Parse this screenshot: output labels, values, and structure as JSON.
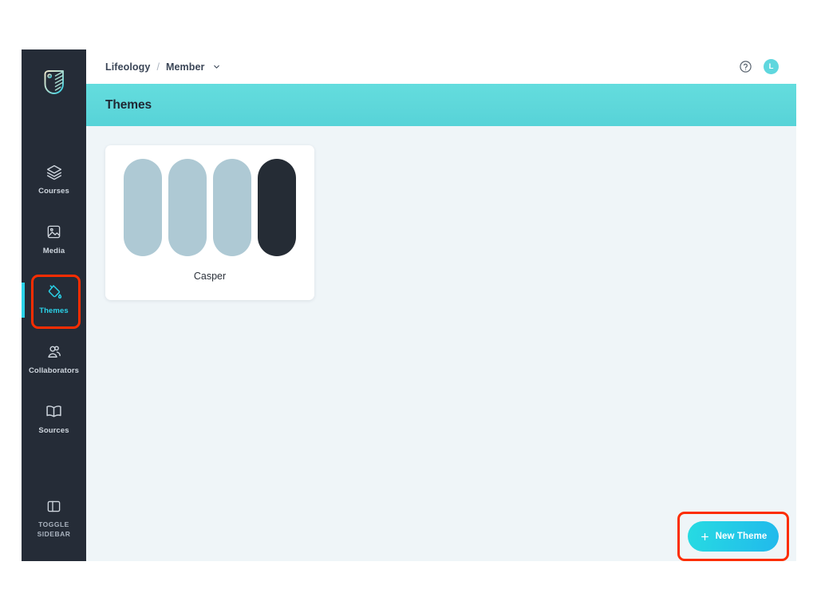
{
  "app": {
    "logo_icon": "lifeology-shield-bird-logo"
  },
  "sidebar": {
    "items": [
      {
        "label": "Courses",
        "icon": "layers-icon",
        "active": false
      },
      {
        "label": "Media",
        "icon": "image-icon",
        "active": false
      },
      {
        "label": "Themes",
        "icon": "paint-bucket-icon",
        "active": true
      },
      {
        "label": "Collaborators",
        "icon": "people-icon",
        "active": false
      },
      {
        "label": "Sources",
        "icon": "book-icon",
        "active": false
      }
    ],
    "toggle": {
      "line1": "TOGGLE",
      "line2": "SIDEBAR",
      "icon": "sidebar-panel-icon"
    }
  },
  "topbar": {
    "breadcrumb": {
      "root": "Lifeology",
      "separator": "/",
      "current": "Member",
      "caret_icon": "chevron-down-icon"
    },
    "help_icon": "question-circle-icon",
    "avatar_initial": "L"
  },
  "header": {
    "title": "Themes"
  },
  "content": {
    "themes": [
      {
        "name": "Casper",
        "swatches": [
          "#aec9d4",
          "#aec9d4",
          "#aec9d4",
          "#252c35"
        ]
      }
    ],
    "new_theme_button": {
      "label": "New Theme",
      "icon": "plus-icon"
    }
  },
  "colors": {
    "sidebar_bg": "#252c37",
    "accent_cyan": "#2ad2e8",
    "header_band": "#5ed7da",
    "content_bg": "#eff5f8",
    "annotation_red": "#fc2d00",
    "avatar_bg": "#5fd7de"
  }
}
